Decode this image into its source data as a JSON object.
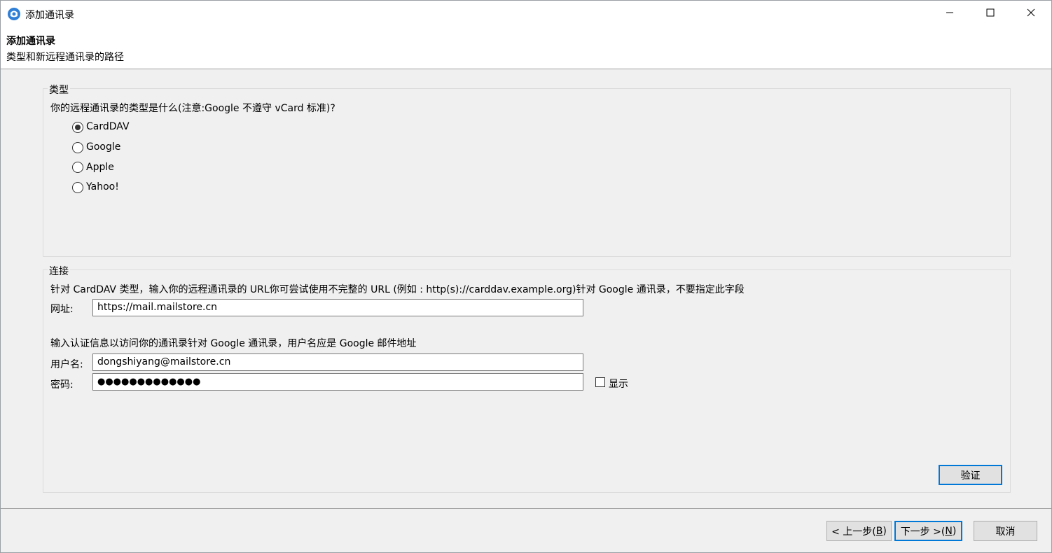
{
  "window": {
    "title": "添加通讯录",
    "controls": {
      "minimize": "minimize-icon",
      "maximize": "maximize-icon",
      "close": "close-icon"
    }
  },
  "header": {
    "title": "添加通讯录",
    "subtitle": "类型和新远程通讯录的路径"
  },
  "type_group": {
    "legend": "类型",
    "question": "你的远程通讯录的类型是什么(注意:Google 不遵守 vCard 标准)?",
    "options": [
      {
        "label": "CardDAV",
        "checked": true
      },
      {
        "label": "Google",
        "checked": false
      },
      {
        "label": "Apple",
        "checked": false
      },
      {
        "label": "Yahoo!",
        "checked": false
      }
    ]
  },
  "connection_group": {
    "legend": "连接",
    "url_hint": "针对 CardDAV 类型，输入你的远程通讯录的 URL你可尝试使用不完整的 URL (例如 : http(s)://carddav.example.org)针对 Google 通讯录，不要指定此字段",
    "url_label": "网址:",
    "url_value": "https://mail.mailstore.cn",
    "auth_hint": "输入认证信息以访问你的通讯录针对 Google 通讯录，用户名应是 Google 邮件地址",
    "username_label": "用户名:",
    "username_value": "dongshiyang@mailstore.cn",
    "password_label": "密码:",
    "password_value": "●●●●●●●●●●●●●",
    "show_label": "显示",
    "verify_button": "验证"
  },
  "footer": {
    "back_button": "< 上一步(",
    "back_key": "B",
    "back_tail": ")",
    "next_button": "下一步 >(",
    "next_key": "N",
    "next_tail": ")",
    "cancel_button": "取消"
  },
  "colors": {
    "accent": "#0078d7",
    "background": "#f0f0f0",
    "app_icon": "#2f7fd6"
  }
}
